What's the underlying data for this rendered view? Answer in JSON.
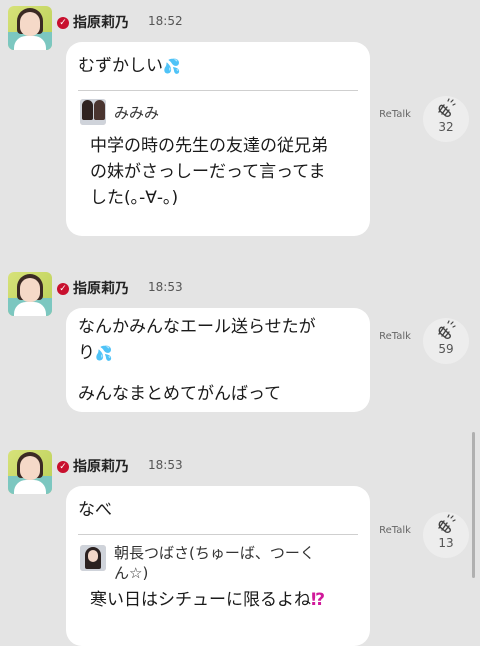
{
  "messages": [
    {
      "name": "指原莉乃",
      "time": "18:52",
      "text": "むずかしい",
      "emoji": "💦",
      "quote": {
        "name": "みみみ",
        "text_lines": [
          "中学の時の先生の友達の従兄弟",
          "の妹がさっしーだって言ってま",
          "した(｡-∀-｡)"
        ]
      },
      "retalk_label": "ReTalk",
      "clap_count": "32"
    },
    {
      "name": "指原莉乃",
      "time": "18:53",
      "text_lines": [
        "なんかみんなエール送らせたが",
        "り",
        "",
        "みんなまとめてがんばって"
      ],
      "emoji": "💦",
      "retalk_label": "ReTalk",
      "clap_count": "59"
    },
    {
      "name": "指原莉乃",
      "time": "18:53",
      "text": "なべ",
      "quote": {
        "name_lines": [
          "朝長つばさ(ちゅーば、つーく",
          "ん☆)"
        ],
        "text": "寒い日はシチューに限るよね",
        "mark": "⁉"
      },
      "retalk_label": "ReTalk",
      "clap_count": "13"
    }
  ]
}
